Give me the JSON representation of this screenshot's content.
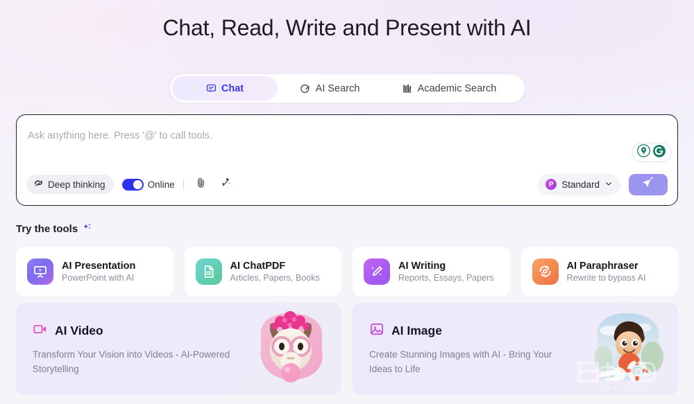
{
  "page": {
    "title": "Chat, Read, Write and Present with AI",
    "accent": "#3b3ae0",
    "background": "#f4f5f9"
  },
  "tabs": [
    {
      "label": "Chat",
      "icon": "chat-bubble-icon",
      "active": true
    },
    {
      "label": "AI Search",
      "icon": "compass-search-icon",
      "active": false
    },
    {
      "label": "Academic Search",
      "icon": "library-books-icon",
      "active": false
    }
  ],
  "composer": {
    "placeholder": "Ask anything here. Press '@' to call tools.",
    "value": "",
    "deep_thinking_label": "Deep thinking",
    "deep_thinking_icon": "brain-icon",
    "online_label": "Online",
    "online_enabled": true,
    "toggle_color": "#2f2ff0",
    "attach_icon": "paperclip-icon",
    "magic_icon": "magic-wand-icon",
    "model_label": "Standard",
    "model_icon": "model-avatar-icon",
    "chevron_icon": "chevron-down-icon",
    "send_icon": "send-paper-plane-icon",
    "send_color": "#9b95f0",
    "grammarly": {
      "bulb_icon": "grammarly-suggestion-bulb-icon",
      "logo_icon": "grammarly-g-icon",
      "color": "#15795f"
    }
  },
  "tools_section": {
    "heading": "Try the tools",
    "sparkle_icon": "sparkle-icon",
    "cards": [
      {
        "title": "AI Presentation",
        "subtitle": "PowerPoint with AI",
        "icon": "presentation-screen-icon",
        "color": "#7b6df0"
      },
      {
        "title": "AI ChatPDF",
        "subtitle": "Articles, Papers, Books",
        "icon": "document-lines-icon",
        "color": "#5ccaa4"
      },
      {
        "title": "AI Writing",
        "subtitle": "Reports, Essays, Papers",
        "icon": "pencil-sparkle-icon",
        "color": "#aa5cf0"
      },
      {
        "title": "AI Paraphraser",
        "subtitle": "Rewrite to bypass AI",
        "icon": "rotate-refresh-icon",
        "color": "#f3874f"
      }
    ]
  },
  "banners": [
    {
      "title": "AI Video",
      "subtitle": "Transform Your Vision into Videos - AI-Powered Storytelling",
      "icon": "video-camera-icon",
      "art": "llama-with-pink-glasses-bubblegum-illustration"
    },
    {
      "title": "AI Image",
      "subtitle": "Create Stunning Images with AI - Bring Your Ideas to Life",
      "icon": "image-photo-icon",
      "art": "cartoon-boy-surfing-illustration"
    }
  ],
  "watermark": {
    "primary": "百果园",
    "secondary": "zhidao.com"
  }
}
